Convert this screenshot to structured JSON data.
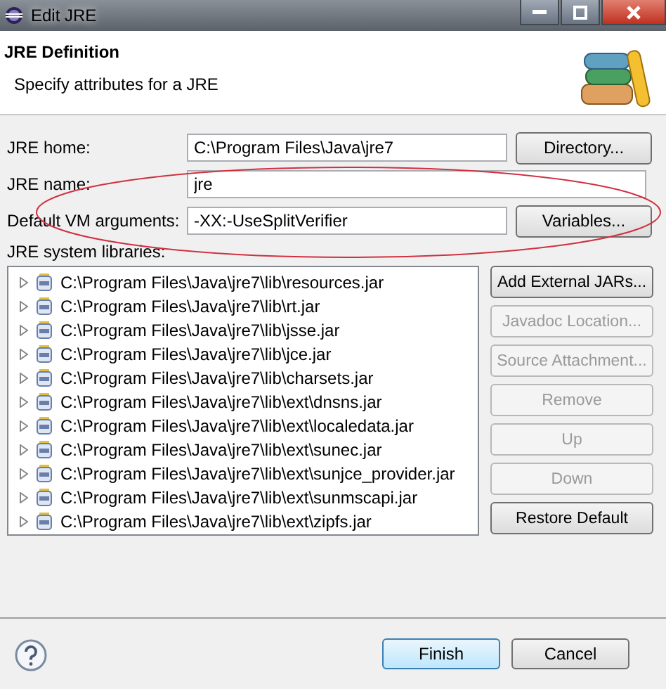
{
  "window": {
    "title": "Edit JRE"
  },
  "header": {
    "title": "JRE Definition",
    "subtitle": "Specify attributes for a JRE"
  },
  "fields": [
    {
      "label": "JRE home:",
      "value": "C:\\Program Files\\Java\\jre7",
      "button": "Directory..."
    },
    {
      "label": "JRE name:",
      "value": "jre"
    },
    {
      "label": "Default VM arguments:",
      "value": "-XX:-UseSplitVerifier",
      "button": "Variables..."
    }
  ],
  "libraries": {
    "label": "JRE system libraries:",
    "items": [
      "C:\\Program Files\\Java\\jre7\\lib\\resources.jar",
      "C:\\Program Files\\Java\\jre7\\lib\\rt.jar",
      "C:\\Program Files\\Java\\jre7\\lib\\jsse.jar",
      "C:\\Program Files\\Java\\jre7\\lib\\jce.jar",
      "C:\\Program Files\\Java\\jre7\\lib\\charsets.jar",
      "C:\\Program Files\\Java\\jre7\\lib\\ext\\dnsns.jar",
      "C:\\Program Files\\Java\\jre7\\lib\\ext\\localedata.jar",
      "C:\\Program Files\\Java\\jre7\\lib\\ext\\sunec.jar",
      "C:\\Program Files\\Java\\jre7\\lib\\ext\\sunjce_provider.jar",
      "C:\\Program Files\\Java\\jre7\\lib\\ext\\sunmscapi.jar",
      "C:\\Program Files\\Java\\jre7\\lib\\ext\\zipfs.jar"
    ],
    "buttons": [
      {
        "label": "Add External JARs...",
        "disabled": false
      },
      {
        "label": "Javadoc Location...",
        "disabled": true
      },
      {
        "label": "Source Attachment...",
        "disabled": true
      },
      {
        "label": "Remove",
        "disabled": true
      },
      {
        "label": "Up",
        "disabled": true
      },
      {
        "label": "Down",
        "disabled": true
      },
      {
        "label": "Restore Default",
        "disabled": false
      }
    ]
  },
  "footer": {
    "buttons": [
      {
        "label": "Finish",
        "default": true
      },
      {
        "label": "Cancel",
        "default": false
      }
    ]
  }
}
